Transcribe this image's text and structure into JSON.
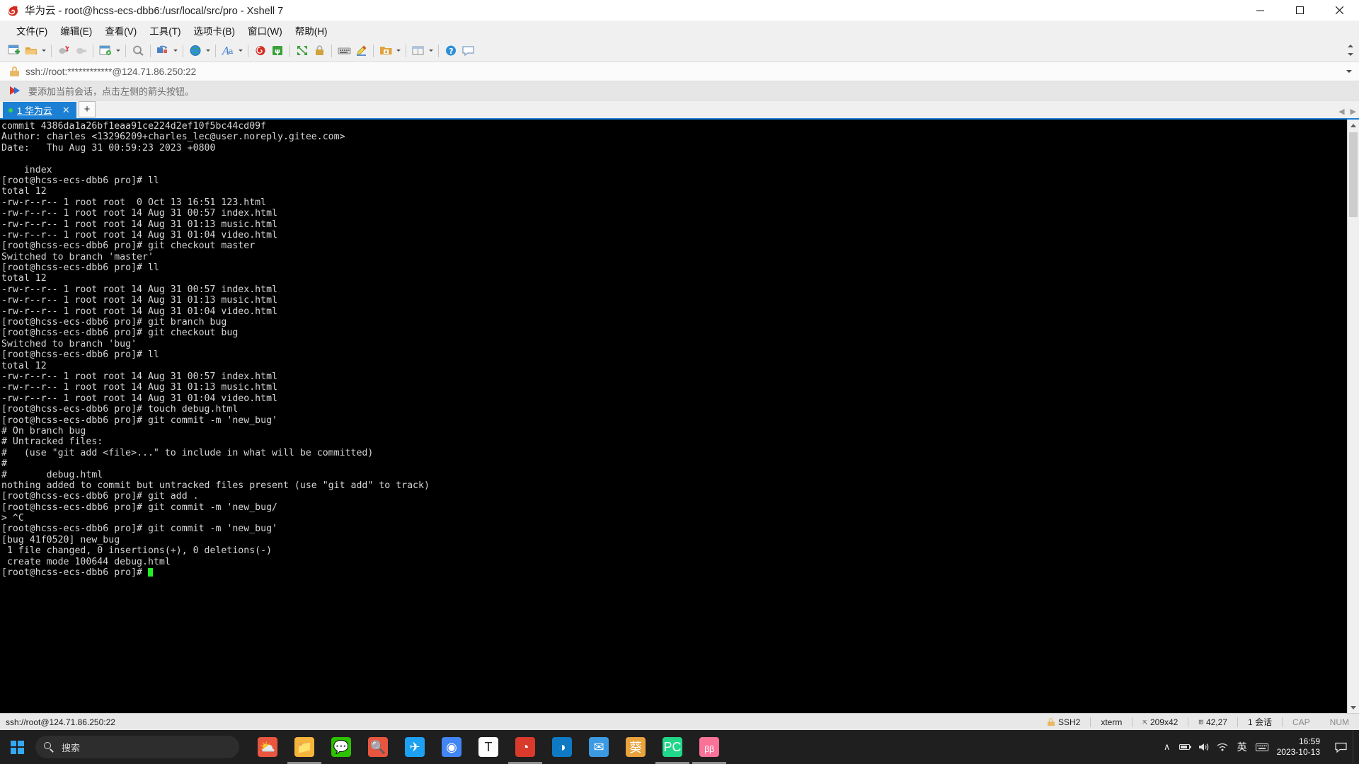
{
  "window": {
    "title": "华为云 - root@hcss-ecs-dbb6:/usr/local/src/pro - Xshell 7",
    "app_icon": "xshell-logo-icon",
    "minimize": "–",
    "maximize": "☐",
    "close": "✕"
  },
  "menu": {
    "items": [
      {
        "label": "文件(F)",
        "name": "menu-file"
      },
      {
        "label": "编辑(E)",
        "name": "menu-edit"
      },
      {
        "label": "查看(V)",
        "name": "menu-view"
      },
      {
        "label": "工具(T)",
        "name": "menu-tools"
      },
      {
        "label": "选项卡(B)",
        "name": "menu-tab"
      },
      {
        "label": "窗口(W)",
        "name": "menu-window"
      },
      {
        "label": "帮助(H)",
        "name": "menu-help"
      }
    ]
  },
  "toolbar": {
    "overflow": "toolbar-overflow-chevrons"
  },
  "address": {
    "value": "ssh://root:************@124.71.86.250:22",
    "lock_icon": "lock-icon",
    "dropdown_icon": "chevron-down-icon"
  },
  "notice": {
    "text": "要添加当前会话，点击左侧的箭头按钮。",
    "icon": "arrow-flag-icon"
  },
  "tabs": {
    "items": [
      {
        "label": "1 华为云",
        "status": "connected",
        "close": "✕"
      }
    ],
    "new_tab": "+",
    "nav_left": "◀",
    "nav_right": "▶"
  },
  "terminal": {
    "lines": [
      "commit 4386da1a26bf1eaa91ce224d2ef10f5bc44cd09f",
      "Author: charles <13296209+charles_lec@user.noreply.gitee.com>",
      "Date:   Thu Aug 31 00:59:23 2023 +0800",
      "",
      "    index",
      "[root@hcss-ecs-dbb6 pro]# ll",
      "total 12",
      "-rw-r--r-- 1 root root  0 Oct 13 16:51 123.html",
      "-rw-r--r-- 1 root root 14 Aug 31 00:57 index.html",
      "-rw-r--r-- 1 root root 14 Aug 31 01:13 music.html",
      "-rw-r--r-- 1 root root 14 Aug 31 01:04 video.html",
      "[root@hcss-ecs-dbb6 pro]# git checkout master",
      "Switched to branch 'master'",
      "[root@hcss-ecs-dbb6 pro]# ll",
      "total 12",
      "-rw-r--r-- 1 root root 14 Aug 31 00:57 index.html",
      "-rw-r--r-- 1 root root 14 Aug 31 01:13 music.html",
      "-rw-r--r-- 1 root root 14 Aug 31 01:04 video.html",
      "[root@hcss-ecs-dbb6 pro]# git branch bug",
      "[root@hcss-ecs-dbb6 pro]# git checkout bug",
      "Switched to branch 'bug'",
      "[root@hcss-ecs-dbb6 pro]# ll",
      "total 12",
      "-rw-r--r-- 1 root root 14 Aug 31 00:57 index.html",
      "-rw-r--r-- 1 root root 14 Aug 31 01:13 music.html",
      "-rw-r--r-- 1 root root 14 Aug 31 01:04 video.html",
      "[root@hcss-ecs-dbb6 pro]# touch debug.html",
      "[root@hcss-ecs-dbb6 pro]# git commit -m 'new_bug'",
      "# On branch bug",
      "# Untracked files:",
      "#   (use \"git add <file>...\" to include in what will be committed)",
      "#",
      "#       debug.html",
      "nothing added to commit but untracked files present (use \"git add\" to track)",
      "[root@hcss-ecs-dbb6 pro]# git add .",
      "[root@hcss-ecs-dbb6 pro]# git commit -m 'new_bug/",
      "> ^C",
      "[root@hcss-ecs-dbb6 pro]# git commit -m 'new_bug'",
      "[bug 41f0520] new_bug",
      " 1 file changed, 0 insertions(+), 0 deletions(-)",
      " create mode 100644 debug.html"
    ],
    "prompt": "[root@hcss-ecs-dbb6 pro]# ",
    "cursor_color": "#22ee22",
    "background": "#000000",
    "foreground": "#d6d6d6"
  },
  "statusbar": {
    "connection": "ssh://root@124.71.86.250:22",
    "protocol": "SSH2",
    "terminal_type": "xterm",
    "size": "209x42",
    "cursor_pos": "42,27",
    "sessions": "1 会话",
    "caps": "CAP",
    "num": "NUM",
    "size_icon": "resize-icon",
    "cursor_icon": "cursor-pos-icon",
    "lock_icon": "lock-icon"
  },
  "taskbar": {
    "start": "start-button",
    "search_placeholder": "搜索",
    "apps": [
      {
        "name": "taskbar-app-weather",
        "glyph": "⛅",
        "color": "#e8563f",
        "active": false
      },
      {
        "name": "taskbar-app-file-explorer",
        "glyph": "📁",
        "color": "#f5b53c",
        "active": true
      },
      {
        "name": "taskbar-app-wechat",
        "glyph": "💬",
        "color": "#2dc100",
        "active": false
      },
      {
        "name": "taskbar-app-search-everything",
        "glyph": "🔍",
        "color": "#e8563f",
        "active": false
      },
      {
        "name": "taskbar-app-twitter",
        "glyph": "✈",
        "color": "#1da1f2",
        "active": false
      },
      {
        "name": "taskbar-app-chrome",
        "glyph": "◉",
        "color": "#4285f4",
        "active": false
      },
      {
        "name": "taskbar-app-typora",
        "glyph": "T",
        "color": "#ffffff",
        "active": false
      },
      {
        "name": "taskbar-app-xshell",
        "glyph": "◔",
        "color": "#d93a2b",
        "active": true
      },
      {
        "name": "taskbar-app-edge",
        "glyph": "◑",
        "color": "#0e7ac4",
        "active": false
      },
      {
        "name": "taskbar-app-mail",
        "glyph": "✉",
        "color": "#3b9ae1",
        "active": false
      },
      {
        "name": "taskbar-app-kui",
        "glyph": "葵",
        "color": "#e8a33d",
        "active": false
      },
      {
        "name": "taskbar-app-pycharm",
        "glyph": "PC",
        "color": "#21d789",
        "active": true
      },
      {
        "name": "taskbar-app-bilibili",
        "glyph": "ᵦᵦ",
        "color": "#fb7299",
        "active": true
      }
    ],
    "tray": {
      "chevron": "∧",
      "battery": "🖫",
      "volume": "🔊",
      "network": "◠",
      "ime": "英",
      "keyboard": "⌨"
    },
    "clock": {
      "time": "16:59",
      "date": "2023-10-13"
    },
    "notification": "💬"
  }
}
